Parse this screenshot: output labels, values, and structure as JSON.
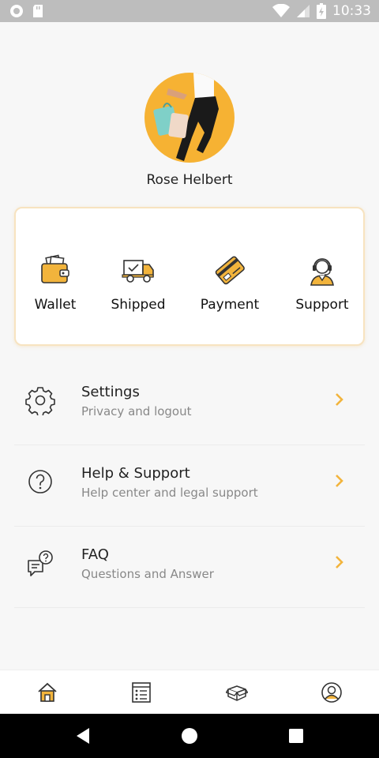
{
  "status_bar": {
    "time": "10:33"
  },
  "profile": {
    "name": "Rose Helbert"
  },
  "quick_actions": [
    {
      "label": "Wallet",
      "icon": "wallet-icon"
    },
    {
      "label": "Shipped",
      "icon": "delivery-truck-icon"
    },
    {
      "label": "Payment",
      "icon": "credit-card-icon"
    },
    {
      "label": "Support",
      "icon": "headset-agent-icon"
    }
  ],
  "menu": [
    {
      "title": "Settings",
      "subtitle": "Privacy and logout",
      "icon": "gear-icon"
    },
    {
      "title": "Help & Support",
      "subtitle": "Help center and legal support",
      "icon": "question-circle-icon"
    },
    {
      "title": "FAQ",
      "subtitle": "Questions and Answer",
      "icon": "chat-question-icon"
    }
  ],
  "bottom_nav": [
    {
      "icon": "home-icon"
    },
    {
      "icon": "list-icon"
    },
    {
      "icon": "box-icon"
    },
    {
      "icon": "profile-icon"
    }
  ],
  "colors": {
    "accent": "#f2b43c",
    "accent_dark": "#e8a21f"
  }
}
